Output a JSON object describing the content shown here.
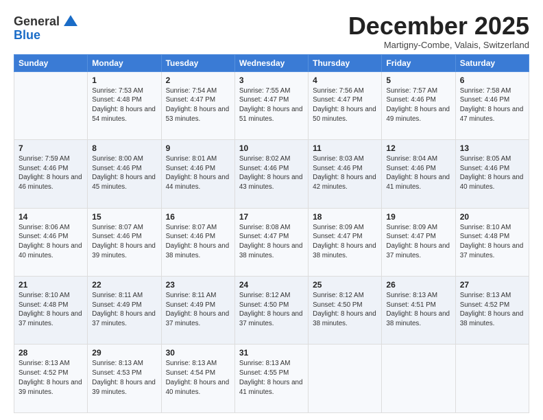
{
  "logo": {
    "general": "General",
    "blue": "Blue"
  },
  "header": {
    "month": "December 2025",
    "location": "Martigny-Combe, Valais, Switzerland"
  },
  "days_of_week": [
    "Sunday",
    "Monday",
    "Tuesday",
    "Wednesday",
    "Thursday",
    "Friday",
    "Saturday"
  ],
  "weeks": [
    [
      {
        "day": "",
        "sunrise": "",
        "sunset": "",
        "daylight": ""
      },
      {
        "day": "1",
        "sunrise": "Sunrise: 7:53 AM",
        "sunset": "Sunset: 4:48 PM",
        "daylight": "Daylight: 8 hours and 54 minutes."
      },
      {
        "day": "2",
        "sunrise": "Sunrise: 7:54 AM",
        "sunset": "Sunset: 4:47 PM",
        "daylight": "Daylight: 8 hours and 53 minutes."
      },
      {
        "day": "3",
        "sunrise": "Sunrise: 7:55 AM",
        "sunset": "Sunset: 4:47 PM",
        "daylight": "Daylight: 8 hours and 51 minutes."
      },
      {
        "day": "4",
        "sunrise": "Sunrise: 7:56 AM",
        "sunset": "Sunset: 4:47 PM",
        "daylight": "Daylight: 8 hours and 50 minutes."
      },
      {
        "day": "5",
        "sunrise": "Sunrise: 7:57 AM",
        "sunset": "Sunset: 4:46 PM",
        "daylight": "Daylight: 8 hours and 49 minutes."
      },
      {
        "day": "6",
        "sunrise": "Sunrise: 7:58 AM",
        "sunset": "Sunset: 4:46 PM",
        "daylight": "Daylight: 8 hours and 47 minutes."
      }
    ],
    [
      {
        "day": "7",
        "sunrise": "Sunrise: 7:59 AM",
        "sunset": "Sunset: 4:46 PM",
        "daylight": "Daylight: 8 hours and 46 minutes."
      },
      {
        "day": "8",
        "sunrise": "Sunrise: 8:00 AM",
        "sunset": "Sunset: 4:46 PM",
        "daylight": "Daylight: 8 hours and 45 minutes."
      },
      {
        "day": "9",
        "sunrise": "Sunrise: 8:01 AM",
        "sunset": "Sunset: 4:46 PM",
        "daylight": "Daylight: 8 hours and 44 minutes."
      },
      {
        "day": "10",
        "sunrise": "Sunrise: 8:02 AM",
        "sunset": "Sunset: 4:46 PM",
        "daylight": "Daylight: 8 hours and 43 minutes."
      },
      {
        "day": "11",
        "sunrise": "Sunrise: 8:03 AM",
        "sunset": "Sunset: 4:46 PM",
        "daylight": "Daylight: 8 hours and 42 minutes."
      },
      {
        "day": "12",
        "sunrise": "Sunrise: 8:04 AM",
        "sunset": "Sunset: 4:46 PM",
        "daylight": "Daylight: 8 hours and 41 minutes."
      },
      {
        "day": "13",
        "sunrise": "Sunrise: 8:05 AM",
        "sunset": "Sunset: 4:46 PM",
        "daylight": "Daylight: 8 hours and 40 minutes."
      }
    ],
    [
      {
        "day": "14",
        "sunrise": "Sunrise: 8:06 AM",
        "sunset": "Sunset: 4:46 PM",
        "daylight": "Daylight: 8 hours and 40 minutes."
      },
      {
        "day": "15",
        "sunrise": "Sunrise: 8:07 AM",
        "sunset": "Sunset: 4:46 PM",
        "daylight": "Daylight: 8 hours and 39 minutes."
      },
      {
        "day": "16",
        "sunrise": "Sunrise: 8:07 AM",
        "sunset": "Sunset: 4:46 PM",
        "daylight": "Daylight: 8 hours and 38 minutes."
      },
      {
        "day": "17",
        "sunrise": "Sunrise: 8:08 AM",
        "sunset": "Sunset: 4:47 PM",
        "daylight": "Daylight: 8 hours and 38 minutes."
      },
      {
        "day": "18",
        "sunrise": "Sunrise: 8:09 AM",
        "sunset": "Sunset: 4:47 PM",
        "daylight": "Daylight: 8 hours and 38 minutes."
      },
      {
        "day": "19",
        "sunrise": "Sunrise: 8:09 AM",
        "sunset": "Sunset: 4:47 PM",
        "daylight": "Daylight: 8 hours and 37 minutes."
      },
      {
        "day": "20",
        "sunrise": "Sunrise: 8:10 AM",
        "sunset": "Sunset: 4:48 PM",
        "daylight": "Daylight: 8 hours and 37 minutes."
      }
    ],
    [
      {
        "day": "21",
        "sunrise": "Sunrise: 8:10 AM",
        "sunset": "Sunset: 4:48 PM",
        "daylight": "Daylight: 8 hours and 37 minutes."
      },
      {
        "day": "22",
        "sunrise": "Sunrise: 8:11 AM",
        "sunset": "Sunset: 4:49 PM",
        "daylight": "Daylight: 8 hours and 37 minutes."
      },
      {
        "day": "23",
        "sunrise": "Sunrise: 8:11 AM",
        "sunset": "Sunset: 4:49 PM",
        "daylight": "Daylight: 8 hours and 37 minutes."
      },
      {
        "day": "24",
        "sunrise": "Sunrise: 8:12 AM",
        "sunset": "Sunset: 4:50 PM",
        "daylight": "Daylight: 8 hours and 37 minutes."
      },
      {
        "day": "25",
        "sunrise": "Sunrise: 8:12 AM",
        "sunset": "Sunset: 4:50 PM",
        "daylight": "Daylight: 8 hours and 38 minutes."
      },
      {
        "day": "26",
        "sunrise": "Sunrise: 8:13 AM",
        "sunset": "Sunset: 4:51 PM",
        "daylight": "Daylight: 8 hours and 38 minutes."
      },
      {
        "day": "27",
        "sunrise": "Sunrise: 8:13 AM",
        "sunset": "Sunset: 4:52 PM",
        "daylight": "Daylight: 8 hours and 38 minutes."
      }
    ],
    [
      {
        "day": "28",
        "sunrise": "Sunrise: 8:13 AM",
        "sunset": "Sunset: 4:52 PM",
        "daylight": "Daylight: 8 hours and 39 minutes."
      },
      {
        "day": "29",
        "sunrise": "Sunrise: 8:13 AM",
        "sunset": "Sunset: 4:53 PM",
        "daylight": "Daylight: 8 hours and 39 minutes."
      },
      {
        "day": "30",
        "sunrise": "Sunrise: 8:13 AM",
        "sunset": "Sunset: 4:54 PM",
        "daylight": "Daylight: 8 hours and 40 minutes."
      },
      {
        "day": "31",
        "sunrise": "Sunrise: 8:13 AM",
        "sunset": "Sunset: 4:55 PM",
        "daylight": "Daylight: 8 hours and 41 minutes."
      },
      {
        "day": "",
        "sunrise": "",
        "sunset": "",
        "daylight": ""
      },
      {
        "day": "",
        "sunrise": "",
        "sunset": "",
        "daylight": ""
      },
      {
        "day": "",
        "sunrise": "",
        "sunset": "",
        "daylight": ""
      }
    ]
  ]
}
